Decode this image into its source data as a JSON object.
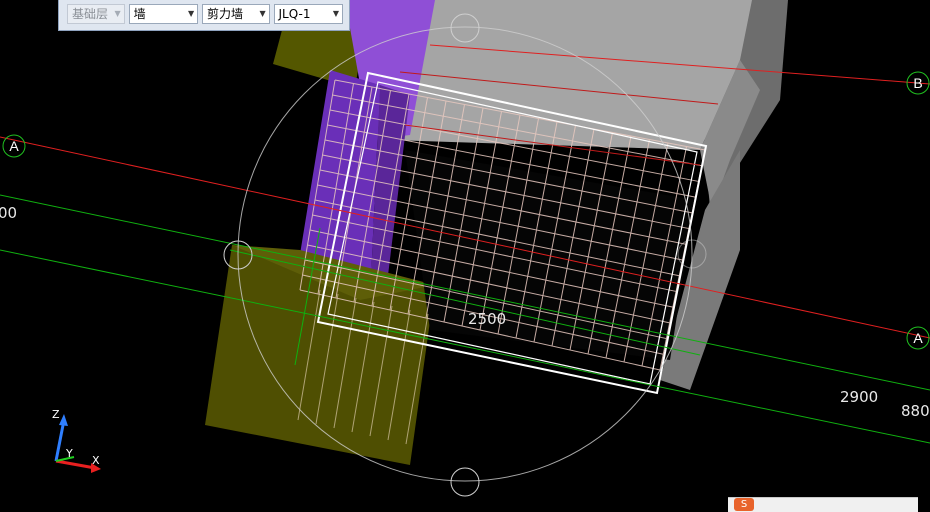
{
  "toolbar": {
    "floor": "基础层",
    "category": "墙",
    "type": "剪力墙",
    "element": "JLQ-1"
  },
  "axes": {
    "left_A": "A",
    "right_A": "A",
    "right_B": "B"
  },
  "dimensions": {
    "left_partial": "00",
    "center": "2500",
    "right_1": "2900",
    "right_2": "880"
  },
  "gizmo": {
    "z": "Z",
    "y": "Y",
    "x": "X"
  },
  "colors": {
    "axis_line": "#e02020",
    "grid_line": "#10b010",
    "wall_purple": "#7a3bc6",
    "footing_olive": "#565500",
    "slab_gray": "#9a9a9a",
    "rebar": "#e8c9c0"
  },
  "taskbar": {
    "logo": "S"
  }
}
